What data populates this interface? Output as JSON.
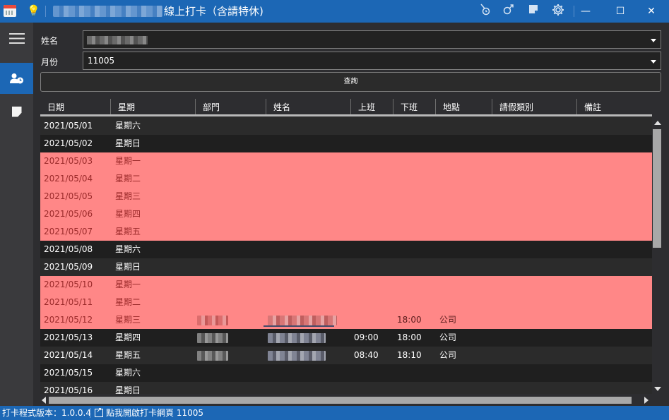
{
  "window": {
    "title": "線上打卡（含請特休)",
    "buttons": {
      "minimize": "—",
      "maximize": "☐",
      "close": "✕"
    }
  },
  "toolbar_icons": [
    "timer-icon",
    "male-icon",
    "note-icon",
    "gear-icon"
  ],
  "sidebar": {
    "items": [
      {
        "name": "menu-icon",
        "active": false
      },
      {
        "name": "person-clock-icon",
        "active": true
      },
      {
        "name": "note-icon",
        "active": false
      }
    ]
  },
  "form": {
    "name_label": "姓名",
    "name_value": "",
    "month_label": "月份",
    "month_value": "11005",
    "query_label": "查詢"
  },
  "grid": {
    "columns": [
      "日期",
      "星期",
      "部門",
      "姓名",
      "上班",
      "下班",
      "地點",
      "請假類別",
      "備註"
    ],
    "rows": [
      {
        "date": "2021/05/01",
        "weekday": "星期六",
        "in": "",
        "out": "",
        "location": "",
        "style": "odd"
      },
      {
        "date": "2021/05/02",
        "weekday": "星期日",
        "in": "",
        "out": "",
        "location": "",
        "style": "even"
      },
      {
        "date": "2021/05/03",
        "weekday": "星期一",
        "in": "",
        "out": "",
        "location": "",
        "style": "hl"
      },
      {
        "date": "2021/05/04",
        "weekday": "星期二",
        "in": "",
        "out": "",
        "location": "",
        "style": "hl"
      },
      {
        "date": "2021/05/05",
        "weekday": "星期三",
        "in": "",
        "out": "",
        "location": "",
        "style": "hl"
      },
      {
        "date": "2021/05/06",
        "weekday": "星期四",
        "in": "",
        "out": "",
        "location": "",
        "style": "hl"
      },
      {
        "date": "2021/05/07",
        "weekday": "星期五",
        "in": "",
        "out": "",
        "location": "",
        "style": "hl"
      },
      {
        "date": "2021/05/08",
        "weekday": "星期六",
        "in": "",
        "out": "",
        "location": "",
        "style": "even"
      },
      {
        "date": "2021/05/09",
        "weekday": "星期日",
        "in": "",
        "out": "",
        "location": "",
        "style": "odd"
      },
      {
        "date": "2021/05/10",
        "weekday": "星期一",
        "in": "",
        "out": "",
        "location": "",
        "style": "hl"
      },
      {
        "date": "2021/05/11",
        "weekday": "星期二",
        "in": "",
        "out": "",
        "location": "",
        "style": "hl"
      },
      {
        "date": "2021/05/12",
        "weekday": "星期三",
        "in": "",
        "out": "18:00",
        "location": "公司",
        "style": "hl"
      },
      {
        "date": "2021/05/13",
        "weekday": "星期四",
        "in": "09:00",
        "out": "18:00",
        "location": "公司",
        "style": "even"
      },
      {
        "date": "2021/05/14",
        "weekday": "星期五",
        "in": "08:40",
        "out": "18:10",
        "location": "公司",
        "style": "odd"
      },
      {
        "date": "2021/05/15",
        "weekday": "星期六",
        "in": "",
        "out": "",
        "location": "",
        "style": "even"
      },
      {
        "date": "2021/05/16",
        "weekday": "星期日",
        "in": "",
        "out": "",
        "location": "",
        "style": "odd"
      }
    ]
  },
  "statusbar": {
    "version": "打卡程式版本：1.0.0.4",
    "link": "點我開啟打卡網頁 11005"
  },
  "colors": {
    "accent": "#1c67b5",
    "highlight_row": "#ff8787",
    "highlight_text": "#9b2a2a"
  }
}
